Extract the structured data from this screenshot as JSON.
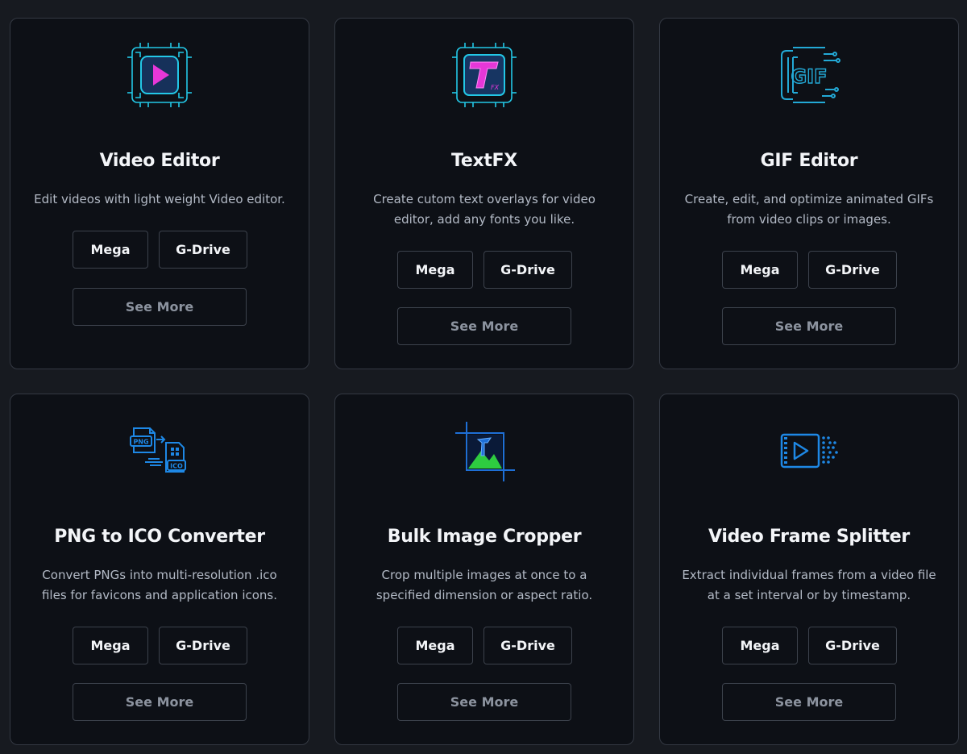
{
  "cards": [
    {
      "title": "Video Editor",
      "description": "Edit videos with light weight Video editor.",
      "icon": "video-editor-icon",
      "mega_label": "Mega",
      "gdrive_label": "G-Drive",
      "see_more_label": "See More"
    },
    {
      "title": "TextFX",
      "description": "Create cutom text overlays for video editor, add any fonts you like.",
      "icon": "textfx-icon",
      "mega_label": "Mega",
      "gdrive_label": "G-Drive",
      "see_more_label": "See More"
    },
    {
      "title": "GIF Editor",
      "description": "Create, edit, and optimize animated GIFs from video clips or images.",
      "icon": "gif-icon",
      "mega_label": "Mega",
      "gdrive_label": "G-Drive",
      "see_more_label": "See More"
    },
    {
      "title": "PNG to ICO Converter",
      "description": "Convert PNGs into multi-resolution .ico files for favicons and application icons.",
      "icon": "png-to-ico-icon",
      "mega_label": "Mega",
      "gdrive_label": "G-Drive",
      "see_more_label": "See More"
    },
    {
      "title": "Bulk Image Cropper",
      "description": "Crop multiple images at once to a specified dimension or aspect ratio.",
      "icon": "image-cropper-icon",
      "mega_label": "Mega",
      "gdrive_label": "G-Drive",
      "see_more_label": "See More"
    },
    {
      "title": "Video Frame Splitter",
      "description": "Extract individual frames from a video file at a set interval or by timestamp.",
      "icon": "video-frame-splitter-icon",
      "mega_label": "Mega",
      "gdrive_label": "G-Drive",
      "see_more_label": "See More"
    }
  ],
  "colors": {
    "page_background": "#171a20",
    "card_background": "#0d1016",
    "card_border": "#343943",
    "title_text": "#f3f5f8",
    "description_text": "#b3bac6",
    "see_more_text": "#8c939f",
    "icon_cyan": "#23c7e6",
    "icon_magenta": "#e637d8",
    "icon_blue": "#1e88e5",
    "icon_green": "#2ecc40"
  }
}
